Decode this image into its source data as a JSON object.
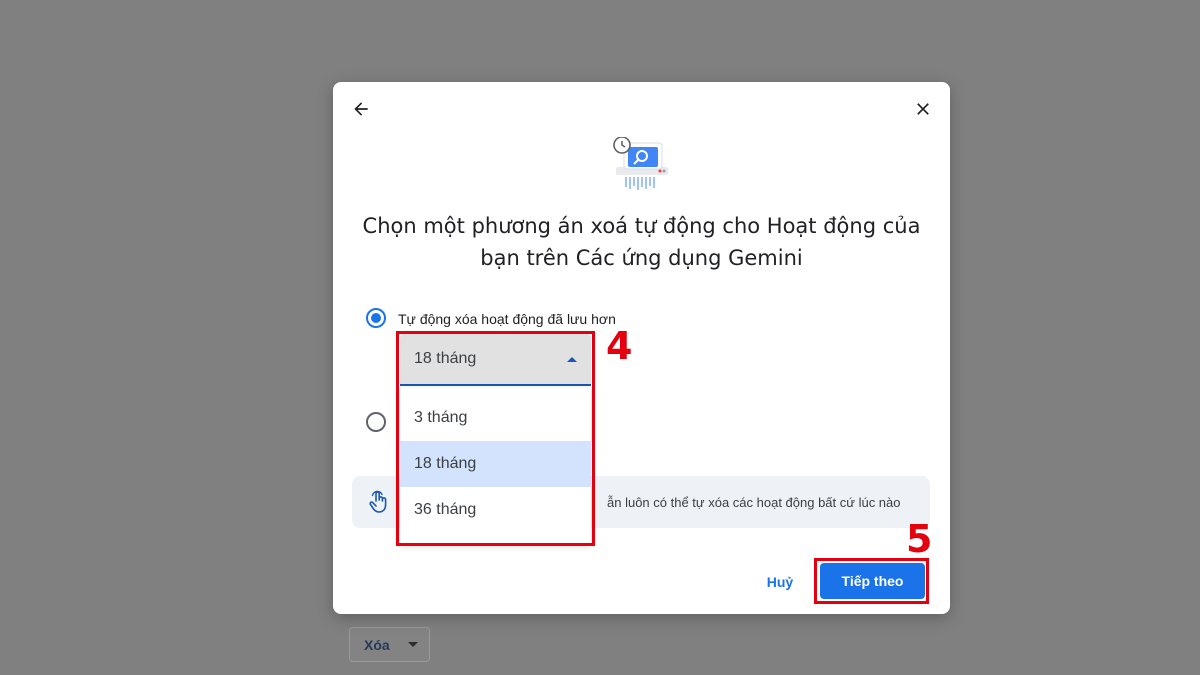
{
  "background": {
    "delete_button_label": "Xóa"
  },
  "dialog": {
    "title": "Chọn một phương án xoá tự động cho Hoạt động của bạn trên Các ứng dụng Gemini",
    "options": [
      {
        "label": "Tự động xóa hoạt động đã lưu hơn",
        "checked": true
      },
      {
        "label": "",
        "checked": false
      }
    ],
    "select": {
      "value": "18 tháng",
      "options": [
        "3 tháng",
        "18 tháng",
        "36 tháng"
      ],
      "selected_index": 1
    },
    "info_text": "ẫn luôn có thể tự xóa các hoạt động bất cứ lúc nào",
    "cancel_label": "Huỷ",
    "next_label": "Tiếp theo"
  },
  "annotations": {
    "step_dropdown": "4",
    "step_next": "5"
  },
  "colors": {
    "accent": "#1a73e8",
    "annotation": "#e3000f",
    "scrim": "#808080",
    "menu_selected": "#d3e3fd"
  }
}
